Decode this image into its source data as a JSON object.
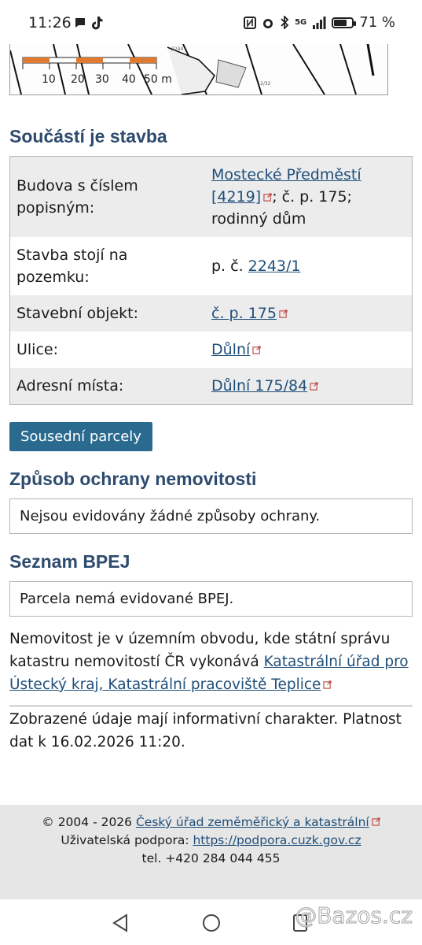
{
  "status": {
    "time": "11:26",
    "network": "5G",
    "battery": "71 %",
    "battery_level": 0.71
  },
  "map": {
    "scale_labels": [
      "10",
      "20",
      "30",
      "40",
      "50 m"
    ]
  },
  "section1": {
    "title": "Součástí je stavba",
    "rows": [
      {
        "key": "Budova s číslem popisným:",
        "link": "Mostecké Předměstí [4219]",
        "rest": "; č. p. 175; rodinný dům"
      },
      {
        "key": "Stavba stojí na pozemku:",
        "prefix": "p. č. ",
        "link": "2243/1"
      },
      {
        "key": "Stavební objekt:",
        "link": "č. p. 175"
      },
      {
        "key": "Ulice:",
        "link": "Důlní"
      },
      {
        "key": "Adresní místa:",
        "link": "Důlní 175/84"
      }
    ]
  },
  "neighbors_button": "Sousední parcely",
  "protection": {
    "title": "Způsob ochrany nemovitosti",
    "text": "Nejsou evidovány žádné způsoby ochrany."
  },
  "bpej": {
    "title": "Seznam BPEJ",
    "text": "Parcela nemá evidované BPEJ."
  },
  "office": {
    "text": "Nemovitost je v územním obvodu, kde státní správu katastru nemovitostí ČR vykonává ",
    "link": "Katastrální úřad pro Ústecký kraj, Katastrální pracoviště Teplice"
  },
  "validity": "Zobrazené údaje mají informativní charakter. Platnost dat k 16.02.2026 11:20.",
  "footer": {
    "copyright": "© 2004 - 2026 ",
    "copyright_link": "Český úřad zeměměřický a katastrální",
    "support_label": "Uživatelská podpora: ",
    "support_link": "https://podpora.cuzk.gov.cz",
    "phone": "tel. +420 284 044 455"
  },
  "watermark": "@Bazos.cz"
}
